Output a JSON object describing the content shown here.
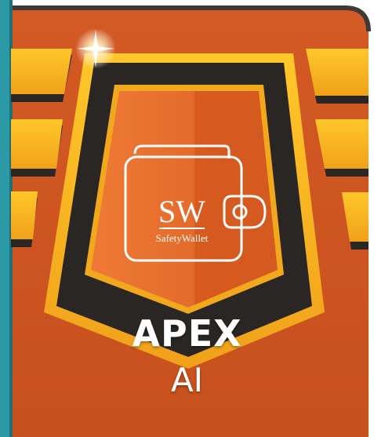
{
  "badge": {
    "title_line1": "APEX",
    "title_line2": "AI"
  },
  "logo": {
    "monogram": "SW",
    "wordmark": "SafetyWallet"
  },
  "colors": {
    "background_orange": "#d9622b",
    "panel_orange": "#e5682a",
    "gold": "#f2a81c",
    "dark_frame": "#2a2623",
    "teal_edge": "#2c9aa6",
    "white": "#ffffff"
  }
}
